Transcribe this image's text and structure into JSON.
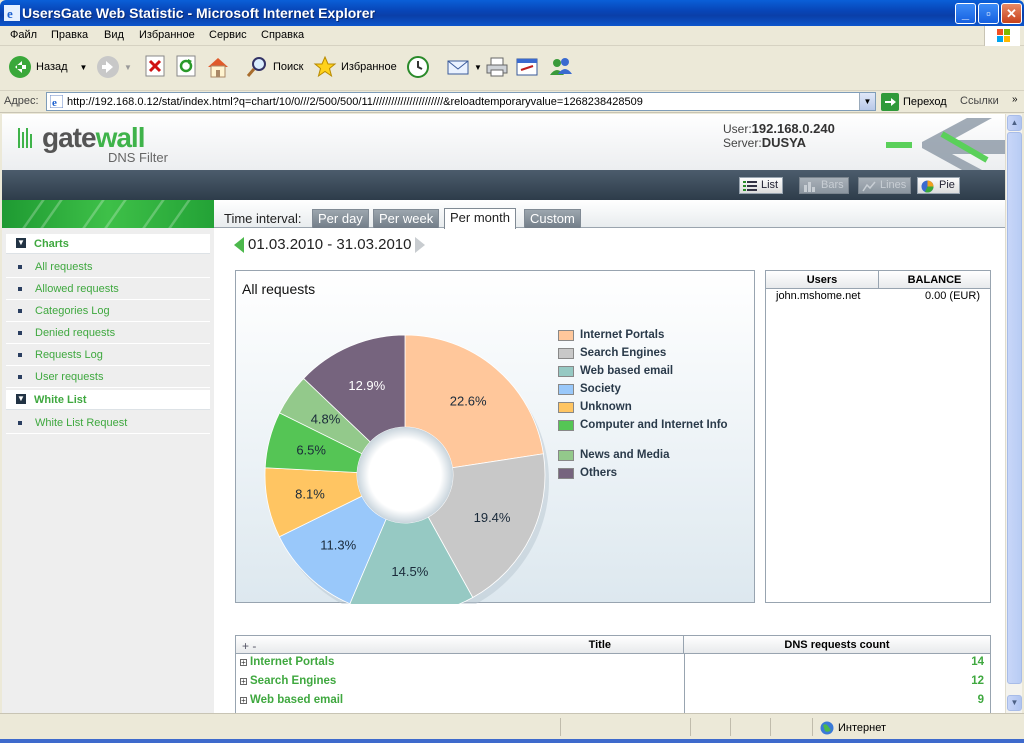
{
  "window": {
    "title": "UsersGate Web Statistic - Microsoft Internet Explorer"
  },
  "menu": [
    "Файл",
    "Правка",
    "Вид",
    "Избранное",
    "Сервис",
    "Справка"
  ],
  "toolbar": {
    "back": "Назад",
    "search": "Поиск",
    "favorites": "Избранное"
  },
  "address": {
    "label": "Адрес:",
    "url": "http://192.168.0.12/stat/index.html?q=chart/10/0///2/500/500/11///////////////////////&reloadtemporaryvalue=1268238428509",
    "go": "Переход",
    "links": "Ссылки"
  },
  "header": {
    "logo_word_a": "gate",
    "logo_word_b": "wall",
    "logo_sub": "DNS Filter",
    "user_label": "User:",
    "user_value": "192.168.0.240",
    "server_label": "Server:",
    "server_value": "DUSYA"
  },
  "views": {
    "list": "List",
    "bars": "Bars",
    "lines": "Lines",
    "pie": "Pie"
  },
  "sidebar": {
    "sections": [
      {
        "label": "Charts",
        "items": [
          "All requests",
          "Allowed requests",
          "Categories Log",
          "Denied requests",
          "Requests Log",
          "User requests"
        ]
      },
      {
        "label": "White List",
        "items": [
          "White List Request"
        ]
      }
    ]
  },
  "interval": {
    "label": "Time interval:",
    "tabs": [
      "Per day",
      "Per week",
      "Per month",
      "Custom"
    ],
    "active": "Per month",
    "range": "01.03.2010 - 31.03.2010"
  },
  "chart_data": {
    "type": "pie",
    "title": "All requests",
    "donut": true,
    "legend": "right",
    "series": [
      {
        "name": "Internet Portals",
        "value": 22.6,
        "label": "22.6%",
        "color": "#ffc79b"
      },
      {
        "name": "Search Engines",
        "value": 19.4,
        "label": "19.4%",
        "color": "#c8c8c8"
      },
      {
        "name": "Web based email",
        "value": 14.5,
        "label": "14.5%",
        "color": "#96c9c3"
      },
      {
        "name": "Society",
        "value": 11.3,
        "label": "11.3%",
        "color": "#99c8fa"
      },
      {
        "name": "Unknown",
        "value": 8.1,
        "label": "8.1%",
        "color": "#ffc562"
      },
      {
        "name": "Computer and Internet Info",
        "value": 6.5,
        "label": "6.5%",
        "color": "#55c555"
      },
      {
        "name": "News and Media",
        "value": 4.8,
        "label": "4.8%",
        "color": "#93c98b"
      },
      {
        "name": "Others",
        "value": 12.9,
        "label": "12.9%",
        "color": "#76647e"
      }
    ]
  },
  "users_table": {
    "headers": [
      "Users",
      "BALANCE"
    ],
    "rows": [
      {
        "user": "john.mshome.net",
        "balance": "0.00 (EUR)"
      }
    ]
  },
  "dns_table": {
    "expand": "+  -",
    "headers": [
      "Title",
      "DNS requests count"
    ],
    "rows": [
      {
        "title": "Internet Portals",
        "count": "14"
      },
      {
        "title": "Search Engines",
        "count": "12"
      },
      {
        "title": "Web based email",
        "count": "9"
      }
    ]
  },
  "status": {
    "zone": "Интернет"
  },
  "colors": {
    "accent_green": "#3fa83f",
    "xp_blue": "#0a5fd8"
  }
}
